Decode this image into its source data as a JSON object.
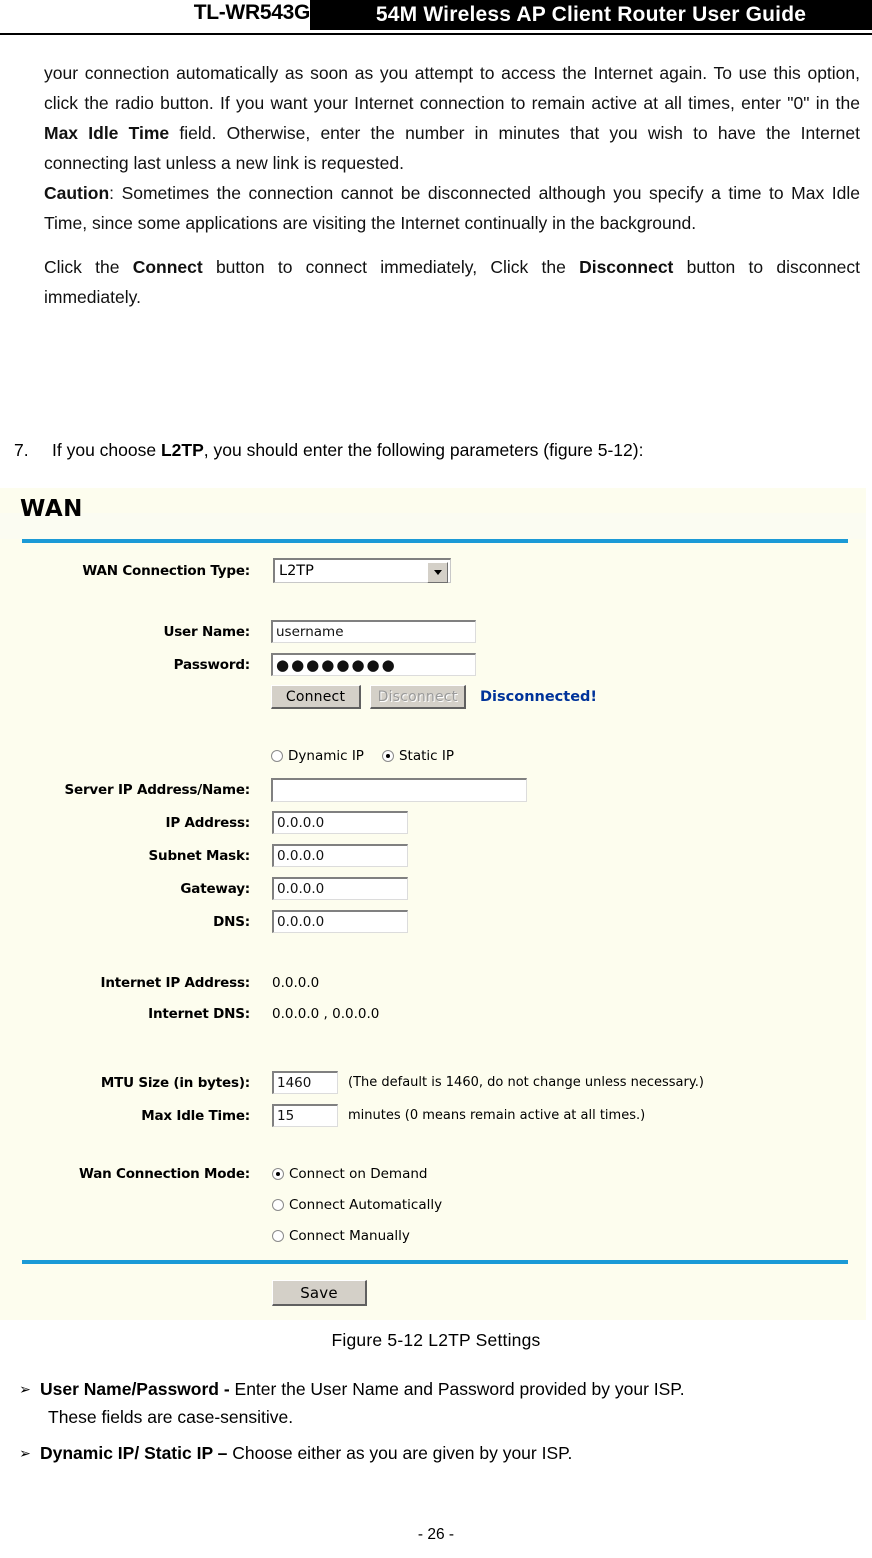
{
  "header": {
    "model": "TL-WR543G",
    "title": "54M  Wireless  AP  Client  Router  User  Guide"
  },
  "prose": {
    "paragraph1_pre": "your connection automatically as soon as you attempt to access the Internet again. To use this option, click the radio button. If you want your Internet connection to remain active at all times, enter \"0\" in the ",
    "paragraph1_bold": "Max Idle Time",
    "paragraph1_post": " field. Otherwise, enter the number in minutes that you wish to have the Internet connecting last unless a new link is requested.",
    "caution_label": "Caution",
    "caution_text": ": Sometimes the connection cannot be disconnected although you specify a time to Max Idle Time, since some applications are visiting the Internet continually in the background.",
    "connect_pre": "Click the ",
    "connect_bold": "Connect",
    "connect_mid": " button to connect immediately, Click the ",
    "disconnect_bold": "Disconnect",
    "connect_post": " button to disconnect immediately."
  },
  "step": {
    "number": "7.",
    "pre": "If you choose ",
    "bold": "L2TP",
    "post": ", you should enter the following parameters (figure 5-12):"
  },
  "wan": {
    "title": "WAN",
    "connection_type_label": "WAN Connection Type:",
    "connection_type_value": "L2TP",
    "connection_type_options": [
      "L2TP"
    ],
    "user_name_label": "User Name:",
    "user_name_value": "username",
    "password_label": "Password:",
    "password_value": "●●●●●●●●",
    "connect_button": "Connect",
    "disconnect_button": "Disconnect",
    "status": "Disconnected!",
    "status_color": "#00339a",
    "ip_mode_dynamic": "Dynamic IP",
    "ip_mode_static": "Static IP",
    "ip_mode_selected": "Static IP",
    "server_ip_label": "Server IP Address/Name:",
    "server_ip_value": "",
    "ip_address_label": "IP Address:",
    "ip_address_value": "0.0.0.0",
    "subnet_mask_label": "Subnet Mask:",
    "subnet_mask_value": "0.0.0.0",
    "gateway_label": "Gateway:",
    "gateway_value": "0.0.0.0",
    "dns_label": "DNS:",
    "dns_value": "0.0.0.0",
    "internet_ip_label": "Internet IP Address:",
    "internet_ip_value": "0.0.0.0",
    "internet_dns_label": "Internet DNS:",
    "internet_dns_value": "0.0.0.0 , 0.0.0.0",
    "mtu_label": "MTU Size (in bytes):",
    "mtu_value": "1460",
    "mtu_note": "(The default is 1460, do not change unless necessary.)",
    "max_idle_label": "Max Idle Time:",
    "max_idle_value": "15",
    "max_idle_note": "minutes (0 means remain active at all times.)",
    "wan_mode_label": "Wan Connection Mode:",
    "wan_mode_option1": "Connect on Demand",
    "wan_mode_option2": "Connect Automatically",
    "wan_mode_option3": "Connect Manually",
    "wan_mode_selected": "Connect on Demand",
    "save_button": "Save",
    "accent_color": "#1b9ad6",
    "panel_background": "#fdfdee"
  },
  "figure": {
    "caption": "Figure 5-12    L2TP Settings"
  },
  "bullets": [
    {
      "mark": "➢",
      "bold": "User Name/Password - ",
      "text": "Enter the User Name and Password provided by your ISP.",
      "continuation": "These fields are case-sensitive."
    },
    {
      "mark": "➢",
      "bold": "Dynamic IP/ Static IP – ",
      "text": "Choose either as you are given by your ISP.",
      "continuation": ""
    }
  ],
  "footer": {
    "page_number": "- 26 -"
  }
}
